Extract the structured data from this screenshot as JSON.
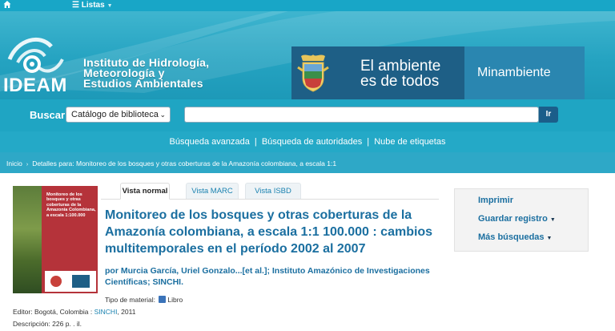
{
  "topnav": {
    "home_icon": "home-icon",
    "listas_label": "Listas"
  },
  "header": {
    "institute_name": [
      "Instituto de Hidrología,",
      "Meteorología y",
      "Estudios Ambientales"
    ],
    "logo_text": "IDEAM",
    "gov_slogan": [
      "El ambiente",
      "es de todos"
    ],
    "ministry": "Minambiente"
  },
  "search": {
    "label": "Buscar",
    "catalog_selected": "Catálogo de biblioteca",
    "query_value": "",
    "button_label": "Ir"
  },
  "links": {
    "advanced": "Búsqueda avanzada",
    "authorities": "Búsqueda de autoridades",
    "tags": "Nube de etiquetas",
    "sep": "|"
  },
  "breadcrumb": {
    "home": "Inicio",
    "current": "Detalles para: Monitoreo de los bosques y otras coberturas de la Amazonía colombiana, a escala 1:1"
  },
  "cover": {
    "title": "Monitoreo de los bosques y otras coberturas de la Amazonía Colombiana, a escala 1:100.000"
  },
  "tabs": [
    {
      "label": "Vista normal",
      "active": true
    },
    {
      "label": "Vista MARC",
      "active": false
    },
    {
      "label": "Vista ISBD",
      "active": false
    }
  ],
  "record": {
    "title": "Monitoreo de los bosques y otras coberturas de la Amazonía colombiana, a escala 1:1 100.000 : cambios multitemporales en el período 2002 al 2007",
    "authors_prefix": "por",
    "authors": "Murcia García, Uriel Gonzalo...[et al.]; Instituto Amazónico de Investigaciones Científicas; SINCHI.",
    "material_label": "Tipo de material:",
    "material_value": "Libro",
    "editor_label": "Editor:",
    "editor_place": "Bogotá, Colombia :",
    "editor_name": "SINCHI",
    "editor_year": ", 2011",
    "description_label": "Descripción:",
    "description_value": "226 p. . il."
  },
  "sidebar": {
    "print": "Imprimir",
    "save": "Guardar registro",
    "more": "Más búsquedas"
  },
  "colors": {
    "accent": "#1fa5c3",
    "link": "#1b6fa0",
    "button": "#1b5e8a"
  }
}
